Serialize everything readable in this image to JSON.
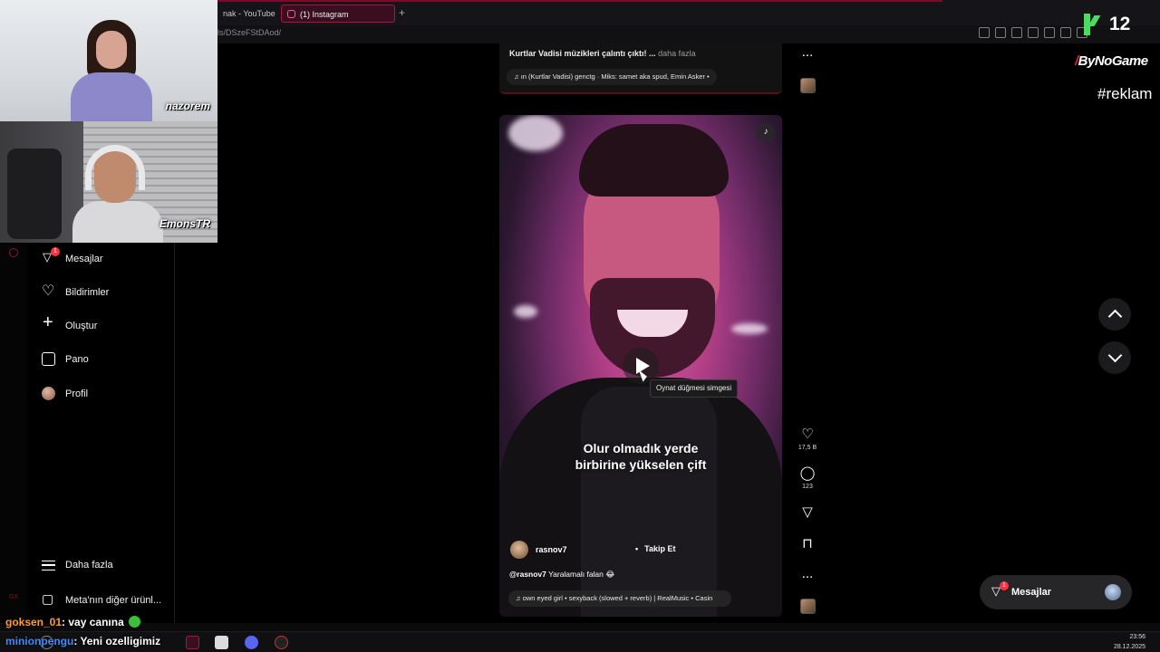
{
  "browser": {
    "tabs": [
      {
        "label": "nak - YouTube"
      },
      {
        "label": "(1) Instagram"
      }
    ],
    "new_tab": "+",
    "url": "ls/DSzeFStDAod/"
  },
  "stream": {
    "cam_labels": [
      "nazorem",
      "EmonsTR"
    ],
    "k_number": "12",
    "sponsor": {
      "prefix": "/",
      "name": "ByNoGame"
    },
    "hashtag": "#reklam",
    "gx_tag": "GX",
    "chat": [
      {
        "user": "goksen_01",
        "message": " vay canına"
      },
      {
        "user": "minionpengu",
        "message": " Yeni ozelligimiz"
      }
    ]
  },
  "nav": {
    "items": [
      {
        "label": "Mesajlar",
        "icon": "send-icon",
        "badge": "1"
      },
      {
        "label": "Bildirimler",
        "icon": "heart-icon"
      },
      {
        "label": "Oluştur",
        "icon": "plus-icon"
      },
      {
        "label": "Pano",
        "icon": "dashboard-icon"
      },
      {
        "label": "Profil",
        "icon": "avatar-icon"
      }
    ],
    "more": "Daha fazla",
    "meta": "Meta'nın diğer ürünl..."
  },
  "prev_post": {
    "caption": "Kurtlar Vadisi müzikleri çalıntı çıktı! ...",
    "more": " daha fazla",
    "music": "♫ ın (Kurtlar Vadisi)  genctg · Miks: samet aka spud, Emin Asker •"
  },
  "reel": {
    "tooltip": "Oynat düğmesi simgesi",
    "overlay_line1": "Olur olmadık yerde",
    "overlay_line2": "birbirine yükselen çift",
    "username": "rasnov7",
    "follow": "Takip Et",
    "caption_user": "@rasnov7",
    "caption_text": " Yaralamalı falan 😂",
    "music": "♫ own eyed girl • sexyback (slowed + reverb) | RealMusic • Casin"
  },
  "actions": {
    "likes": "17,5 B",
    "comments": "123",
    "more": "..."
  },
  "messages_pill": {
    "label": "Mesajlar",
    "badge": "1"
  },
  "clock": {
    "time": "23:56",
    "date": "28.12.2025"
  },
  "colors": {
    "accent": "#ff3040",
    "tab_border": "#b3123d",
    "k_green": "#4cd964",
    "chat_orange": "#ff9c2a",
    "chat_blue": "#3a8cff"
  }
}
